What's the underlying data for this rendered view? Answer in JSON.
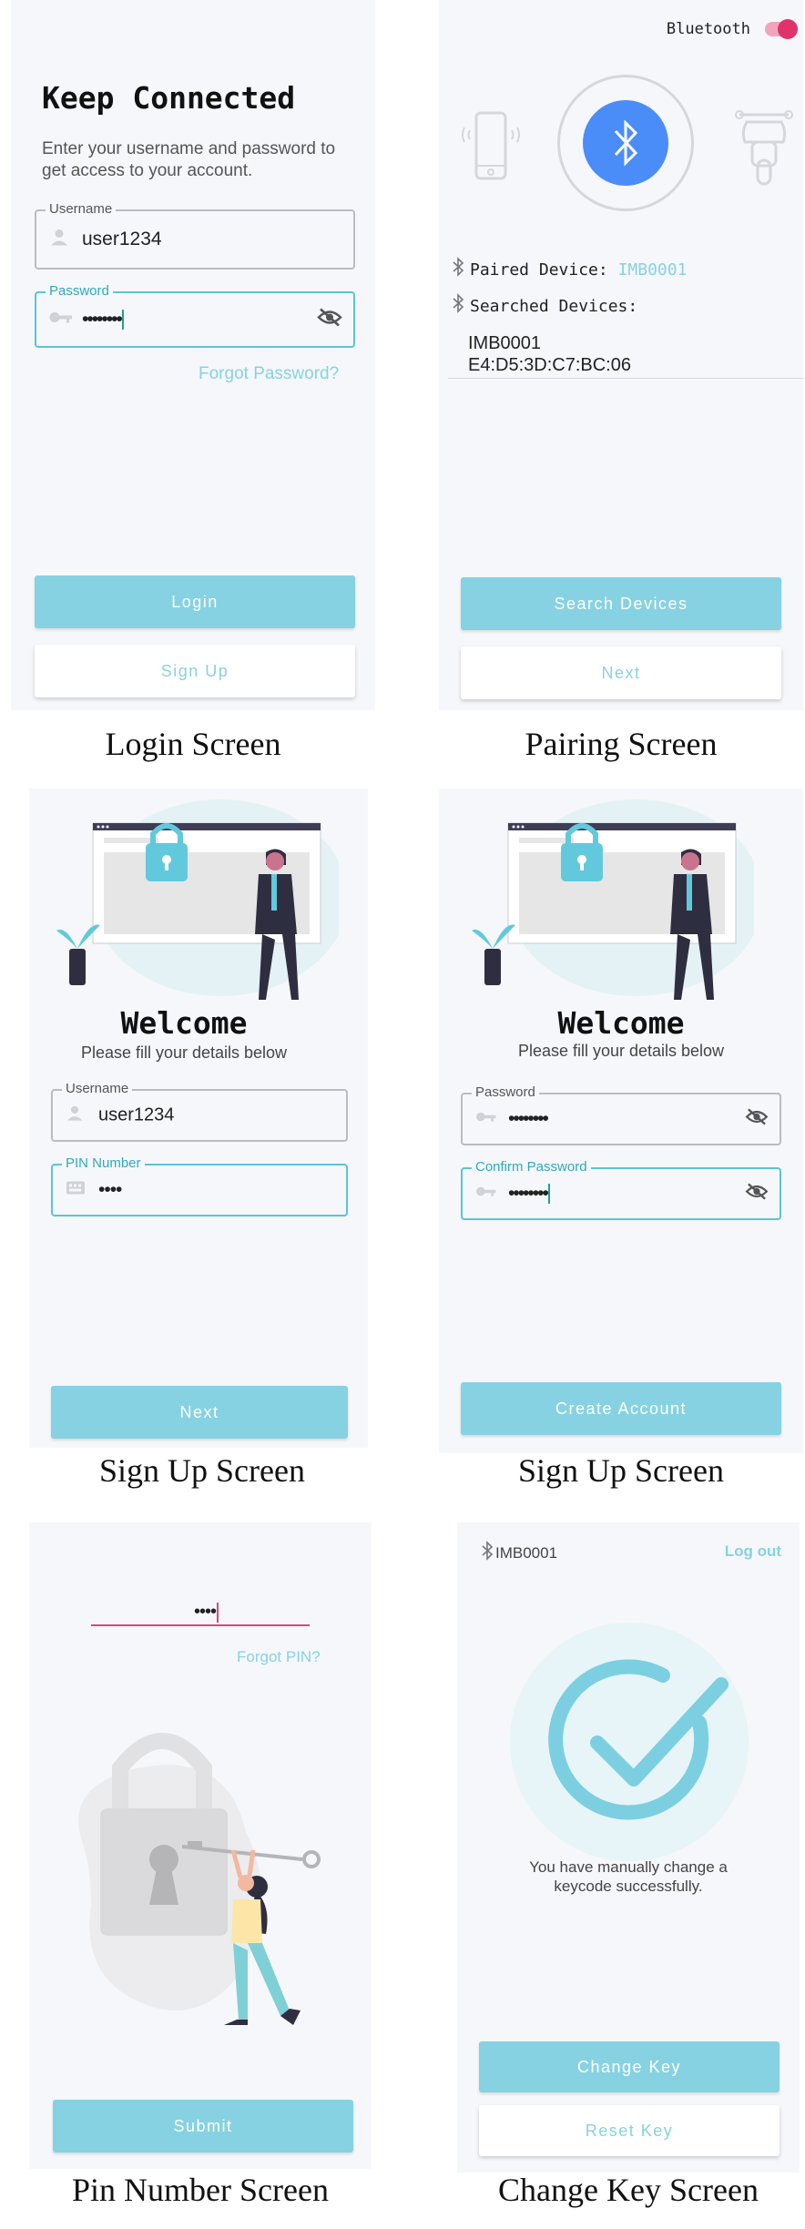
{
  "login": {
    "title": "Keep Connected",
    "description": "Enter your username and password to get access to your account.",
    "username_label": "Username",
    "username_value": "user1234",
    "password_label": "Password",
    "password_value": "••••••••",
    "forgot_password": "Forgot Password?",
    "login_button": "Login",
    "signup_button": "Sign Up",
    "caption": "Login Screen"
  },
  "pairing": {
    "bluetooth_label": "Bluetooth",
    "bluetooth_on": true,
    "paired_label": "Paired Device:",
    "paired_value": "IMB0001",
    "searched_label": "Searched Devices:",
    "device_name": "IMB0001",
    "device_mac": "E4:D5:3D:C7:BC:06",
    "search_button": "Search Devices",
    "next_button": "Next",
    "caption": "Pairing Screen"
  },
  "signup1": {
    "title": "Welcome",
    "subtitle": "Please fill your details below",
    "username_label": "Username",
    "username_value": "user1234",
    "pin_label": "PIN Number",
    "pin_value": "••••",
    "next_button": "Next",
    "caption": "Sign Up Screen"
  },
  "signup2": {
    "title": "Welcome",
    "subtitle": "Please fill your details below",
    "password_label": "Password",
    "password_value": "••••••••",
    "confirm_label": "Confirm Password",
    "confirm_value": "••••••••",
    "create_button": "Create Account",
    "caption": "Sign Up Screen"
  },
  "pin": {
    "pin_value": "••••",
    "forgot_pin": "Forgot PIN?",
    "submit_button": "Submit",
    "caption": "Pin Number Screen"
  },
  "changekey": {
    "device_name": "IMB0001",
    "logout": "Log out",
    "message": "You have manually change a keycode successfully.",
    "change_button": "Change Key",
    "reset_button": "Reset Key",
    "caption": "Change Key Screen"
  },
  "colors": {
    "accent": "#86d2e3",
    "bluetooth_blue": "#4b8df8",
    "toggle_pink": "#e0336b",
    "phone_bg": "#f6f7fa"
  }
}
